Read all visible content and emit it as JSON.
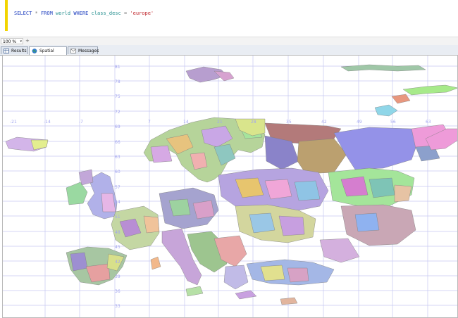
{
  "editor": {
    "tokens": [
      {
        "text": "SELECT",
        "type": "kw"
      },
      {
        "text": " * ",
        "type": "op"
      },
      {
        "text": "FROM",
        "type": "kw"
      },
      {
        "text": " world ",
        "type": "ident"
      },
      {
        "text": "WHERE",
        "type": "kw"
      },
      {
        "text": " class_desc ",
        "type": "ident"
      },
      {
        "text": "=",
        "type": "op"
      },
      {
        "text": " 'europe'",
        "type": "str"
      }
    ]
  },
  "zoom": {
    "value": "100 %",
    "button": "+"
  },
  "tabs": [
    {
      "label": "Results",
      "icon": "grid-icon",
      "active": false
    },
    {
      "label": "Spatial results",
      "icon": "globe-icon",
      "active": true
    },
    {
      "label": "Messages",
      "icon": "message-icon",
      "active": false
    }
  ],
  "map": {
    "longitude_labels": [
      "-21",
      "-14",
      "-7",
      "7",
      "14",
      "21",
      "28",
      "35",
      "42",
      "49",
      "56",
      "63"
    ],
    "latitude_labels": [
      "81",
      "78",
      "75",
      "72",
      "69",
      "66",
      "63",
      "60",
      "57",
      "54",
      "51",
      "48",
      "45",
      "42",
      "39",
      "36",
      "33"
    ],
    "grid_color": "#c6c7f2"
  }
}
